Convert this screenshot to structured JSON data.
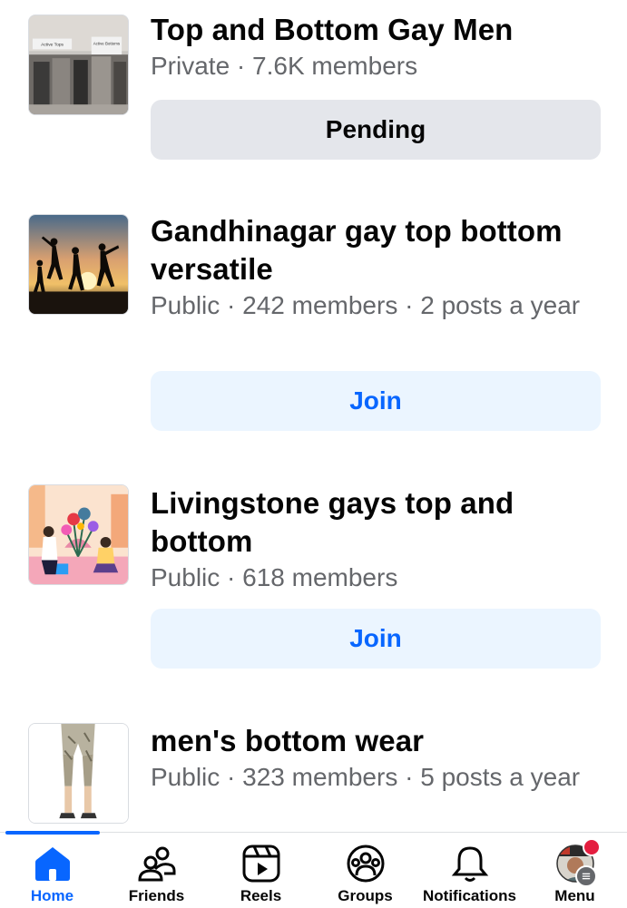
{
  "groups": [
    {
      "name": "Top and Bottom Gay Men",
      "meta": "Private · 7.6K members",
      "button": "Pending",
      "thumb_text_left": "Active Tops",
      "thumb_text_right": "Active Bottoms"
    },
    {
      "name": "Gandhinagar gay top bottom versatile",
      "meta": "Public · 242 members · 2 posts a year",
      "button": "Join"
    },
    {
      "name": "Livingstone gays top and bottom",
      "meta": "Public · 618 members",
      "button": "Join"
    },
    {
      "name": "men's bottom wear",
      "meta": "Public · 323 members · 5 posts a year"
    }
  ],
  "tabs": {
    "home": "Home",
    "friends": "Friends",
    "reels": "Reels",
    "groups": "Groups",
    "notifications": "Notifications",
    "menu": "Menu"
  },
  "colors": {
    "accent": "#0866ff",
    "join_bg": "#ebf5ff",
    "pending_bg": "#e4e6eb",
    "meta_text": "#65676b"
  }
}
